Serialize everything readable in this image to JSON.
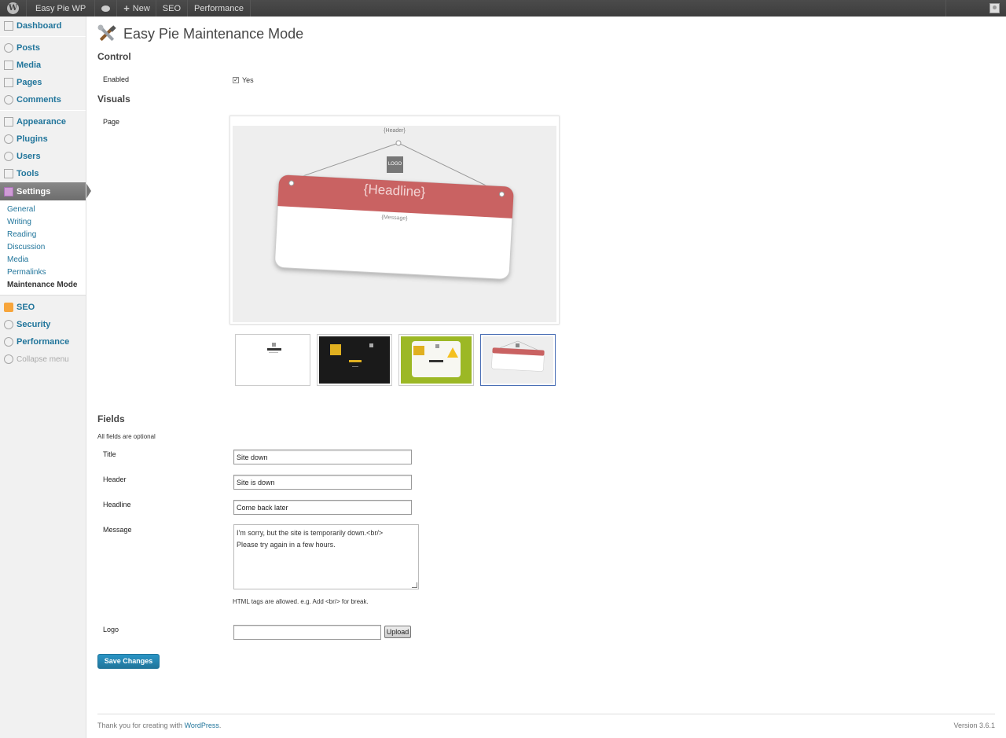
{
  "adminbar": {
    "site_name": "Easy Pie WP",
    "new_label": "New",
    "seo_label": "SEO",
    "performance_label": "Performance"
  },
  "sidebar": {
    "items": [
      {
        "label": "Dashboard",
        "icon": "dashboard-icon"
      },
      {
        "label": "Posts",
        "icon": "pin-icon"
      },
      {
        "label": "Media",
        "icon": "media-icon"
      },
      {
        "label": "Pages",
        "icon": "pages-icon"
      },
      {
        "label": "Comments",
        "icon": "comment-icon"
      },
      {
        "label": "Appearance",
        "icon": "appearance-icon"
      },
      {
        "label": "Plugins",
        "icon": "plug-icon"
      },
      {
        "label": "Users",
        "icon": "users-icon"
      },
      {
        "label": "Tools",
        "icon": "tools-icon"
      },
      {
        "label": "Settings",
        "icon": "settings-icon"
      }
    ],
    "submenu": [
      "General",
      "Writing",
      "Reading",
      "Discussion",
      "Media",
      "Permalinks",
      "Maintenance Mode"
    ],
    "extra": [
      {
        "label": "SEO",
        "icon": "seo-icon"
      },
      {
        "label": "Security",
        "icon": "shield-icon"
      },
      {
        "label": "Performance",
        "icon": "performance-icon"
      }
    ],
    "collapse_label": "Collapse menu"
  },
  "page": {
    "title": "Easy Pie Maintenance Mode",
    "control_heading": "Control",
    "enabled_label": "Enabled",
    "enabled_value": "Yes",
    "enabled_checked": true,
    "visuals_heading": "Visuals",
    "page_label": "Page",
    "preview": {
      "header_text": "{Header}",
      "logo_text": "LOGO",
      "headline_text": "{Headline}",
      "message_text": "{Message}"
    },
    "fields_heading": "Fields",
    "fields_note": "All fields are optional",
    "fields": {
      "title_label": "Title",
      "title_value": "Site down",
      "header_label": "Header",
      "header_value": "Site is down",
      "headline_label": "Headline",
      "headline_value": "Come back later",
      "message_label": "Message",
      "message_value": "I'm sorry, but the site is temporarily down.<br/>\nPlease try again in a few hours.",
      "message_hint": "HTML tags are allowed. e.g. Add <br/> for break.",
      "logo_label": "Logo",
      "logo_value": "",
      "upload_label": "Upload"
    },
    "save_label": "Save Changes"
  },
  "footer": {
    "thanks_prefix": "Thank you for creating with ",
    "thanks_link": "WordPress",
    "thanks_suffix": ".",
    "version": "Version 3.6.1"
  },
  "colors": {
    "link": "#21759b",
    "sign_red": "#c96262",
    "primary_button": "#21759b",
    "theme_dark": "#1a1a1a",
    "theme_green": "#9cb825"
  }
}
